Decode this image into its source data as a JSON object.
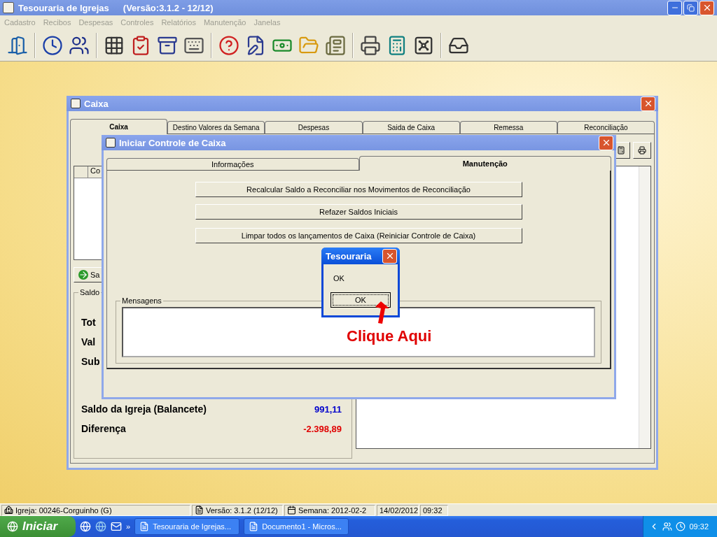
{
  "app": {
    "title": "Tesouraria de Igrejas",
    "version": "(Versão:3.1.2 - 12/12)"
  },
  "menu": [
    {
      "label": "Cadastro",
      "disabled": true
    },
    {
      "label": "Recibos",
      "disabled": true
    },
    {
      "label": "Despesas",
      "disabled": true
    },
    {
      "label": "Controles",
      "disabled": true
    },
    {
      "label": "Relatórios",
      "disabled": true
    },
    {
      "label": "Manutenção",
      "disabled": true
    },
    {
      "label": "Janelas",
      "disabled": true
    }
  ],
  "caixa_window": {
    "title": "Caixa",
    "tabs": [
      {
        "label": "Caixa",
        "selected": true
      },
      {
        "label": "Destino Valores da Semana",
        "selected": false
      },
      {
        "label": "Despesas",
        "selected": false
      },
      {
        "label": "Saida de Caixa",
        "selected": false
      },
      {
        "label": "Remessa",
        "selected": false
      },
      {
        "label": "Reconciliação",
        "selected": false
      }
    ],
    "grid": {
      "column_1": "Co"
    },
    "button": "Sa",
    "saldo": {
      "title": "Saldo",
      "rows": [
        {
          "label": "Tot"
        },
        {
          "label": "Val"
        },
        {
          "label": "Sub"
        },
        {
          "label": "Saldo da Igreja (Balancete)",
          "value": "991,11",
          "color": "#0000cc"
        },
        {
          "label": "Diferença",
          "value": "-2.398,89",
          "color": "#e00000"
        }
      ]
    }
  },
  "dialog": {
    "title": "Iniciar Controle de Caixa",
    "tabs": [
      {
        "label": "Informações",
        "selected": false
      },
      {
        "label": "Manutenção",
        "selected": true
      }
    ],
    "actions": [
      "Recalcular Saldo a Reconciliar nos Movimentos de Reconciliação",
      "Refazer Saldos Iniciais",
      "Limpar todos os lançamentos de Caixa (Reiniciar Controle de Caixa)"
    ],
    "messages": {
      "title": "Mensagens"
    }
  },
  "message_box": {
    "title": "Tesouraria",
    "text": "OK",
    "button": "OK"
  },
  "annotation": {
    "text": "Clique Aqui"
  },
  "status_bar": [
    {
      "kind": "church",
      "text": "Igreja: 00246-Corguinho (G)"
    },
    {
      "kind": "version",
      "text": "Versão: 3.1.2 (12/12)"
    },
    {
      "kind": "week",
      "text": "Semana: 2012-02-2"
    },
    {
      "kind": "plain",
      "text": "14/02/2012"
    },
    {
      "kind": "plain",
      "text": "09:32"
    }
  ],
  "taskbar": {
    "start": "Iniciar",
    "more": "»",
    "tasks": [
      "Tesouraria de Igrejas...",
      "Documento1 - Micros..."
    ],
    "clock": "09:32"
  }
}
